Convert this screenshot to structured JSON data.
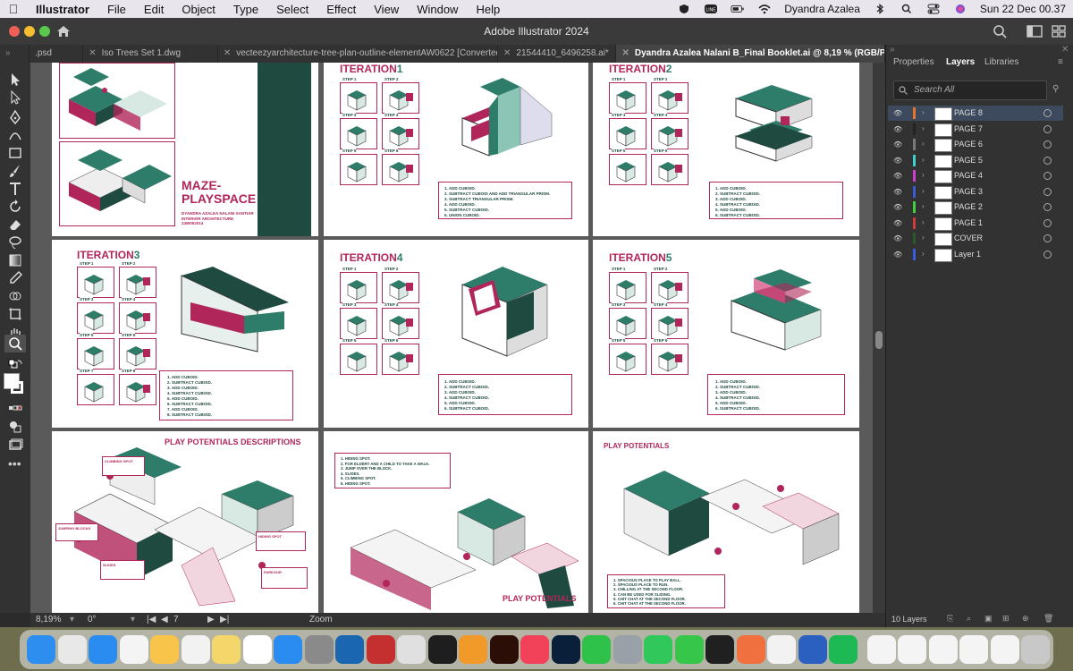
{
  "menubar": {
    "app": "Illustrator",
    "items": [
      "File",
      "Edit",
      "Object",
      "Type",
      "Select",
      "Effect",
      "View",
      "Window",
      "Help"
    ],
    "user": "Dyandra Azalea",
    "clock": "Sun 22 Dec  00.37"
  },
  "window": {
    "title": "Adobe Illustrator 2024"
  },
  "tabs": [
    {
      "label": ".psd"
    },
    {
      "label": "Iso Trees Set 1.dwg"
    },
    {
      "label": "vecteezyarchitecture-tree-plan-outline-elementAW0622 [Converted].eps"
    },
    {
      "label": "21544410_6496258.ai*"
    },
    {
      "label": "Dyandra Azalea Nalani B_Final Booklet.ai @ 8,19 % (RGB/Preview)"
    }
  ],
  "status": {
    "zoom": "8,19%",
    "rotation": "0°",
    "artboard": "7",
    "mode": "Zoom"
  },
  "panel": {
    "tabs": [
      "Properties",
      "Layers",
      "Libraries"
    ],
    "search_placeholder": "Search All",
    "layers": [
      {
        "name": "PAGE 8",
        "color": "#e8732c"
      },
      {
        "name": "PAGE 7",
        "color": "#222222"
      },
      {
        "name": "PAGE 6",
        "color": "#7a7a7a"
      },
      {
        "name": "PAGE 5",
        "color": "#3fd0d0"
      },
      {
        "name": "PAGE 4",
        "color": "#d040d0"
      },
      {
        "name": "PAGE 3",
        "color": "#3b5bd6"
      },
      {
        "name": "PAGE 2",
        "color": "#40d040"
      },
      {
        "name": "PAGE 1",
        "color": "#d03a3a"
      },
      {
        "name": "COVER",
        "color": "#2a5a2a"
      },
      {
        "name": "Layer 1",
        "color": "#3a5ae0"
      }
    ],
    "count": "10 Layers"
  },
  "artboards": {
    "cover": {
      "title1": "MAZE-",
      "title2": "PLAYSPACE",
      "sub1": "DYANDRA AZALEA NALANI SANTIAR",
      "sub2": "INTERIOR ARCHITECTURE",
      "sub3": "24W052014"
    },
    "iter1": {
      "title": "ITERATION",
      "num": "1",
      "notes": [
        "1.  ADD CUBOID.",
        "2.  SUBTRACT CUBOID AND ADD TRIANGULAR PRISM.",
        "3.  SUBTRACT TRIANGULAR PRISM.",
        "4.  ADD CUBOID.",
        "5.  SUBTRACT CUBOID.",
        "6.  UNION CUBOID."
      ]
    },
    "iter2": {
      "title": "ITERATION",
      "num": "2",
      "notes": [
        "1.  ADD CUBOID.",
        "2.  SUBTRACT CUBOID.",
        "3.  ADD CUBOID.",
        "4.  SUBTRACT CUBOID.",
        "5.  ADD CUBOID.",
        "6.  SUBTRACT CUBOID."
      ]
    },
    "iter3": {
      "title": "ITERATION",
      "num": "3",
      "notes": [
        "1.  ADD CUBOID.",
        "2.  SUBTRACT CUBOID.",
        "3.  ADD CUBOID.",
        "4.  SUBTRACT CUBOID.",
        "5.  ADD CUBOID.",
        "6.  SUBTRACT CUBOID.",
        "7.  ADD CUBOID.",
        "8.  SUBTRACT CUBOID."
      ]
    },
    "iter4": {
      "title": "ITERATION",
      "num": "4",
      "notes": [
        "1.  ADD CUBOID.",
        "2.  SUBTRACT CUBOID.",
        "3.  ADD CUBOID.",
        "4.  SUBTRACT CUBOID.",
        "5.  ADD CUBOID.",
        "6.  SUBTRACT CUBOID."
      ]
    },
    "iter5": {
      "title": "ITERATION",
      "num": "5",
      "notes": [
        "1.  ADD CUBOID.",
        "2.  SUBTRACT CUBOID.",
        "3.  ADD CUBOID.",
        "4.  SUBTRACT CUBOID.",
        "5.  ADD CUBOID.",
        "6.  SUBTRACT CUBOID."
      ]
    },
    "steps": [
      "STEP 1",
      "STEP 2",
      "STEP 3",
      "STEP 4",
      "STEP 5",
      "STEP 6",
      "STEP 7",
      "STEP 8"
    ],
    "pp_desc": {
      "title": "PLAY POTENTIALS DESCRIPTIONS",
      "labels": [
        "CLIMBING SPOT",
        "JUMPING BLOCKS",
        "HIDING SPOT",
        "SLIDES",
        "PARKOUR"
      ]
    },
    "pp_mid": {
      "title": "PLAY POTENTIALS",
      "notes": [
        "1.  HIDING SPOT.",
        "2.  FOR ELDERY AND A CHILD TO TAKE A WALK.",
        "3.  JUMP OVER THE BLOCK.",
        "4.  SLIDES.",
        "5.  CLIMBING SPOT.",
        "6.  HIDING SPOT."
      ]
    },
    "pp_right": {
      "title": "PLAY POTENTIALS",
      "notes": [
        "1.  SPACIOUS PLACE TO PLAY BALL.",
        "2.  SPACIOUS PLACE TO RUN.",
        "3.  CHILLING AT THE SECOND FLOOR.",
        "4.  CAN BE USED FOR SLIDING.",
        "5.  CHIT CHAT AT THE SECOND FLOOR.",
        "6.  CHIT CHAT AT THE SECOND FLOOR."
      ]
    }
  },
  "colors": {
    "teal": "#2e7d6b",
    "magenta": "#b0265a",
    "darkgreen": "#1f4a40"
  },
  "dock_icons": [
    "finder",
    "launchpad",
    "safari",
    "photos",
    "notes-app",
    "reminders",
    "notes",
    "freeform",
    "app-store",
    "system-settings",
    "sketchup",
    "autocad",
    "preview",
    "inkscape",
    "pages",
    "illustrator",
    "music",
    "photoshop",
    "whatsapp",
    "calculator",
    "line",
    "messages",
    "terminal",
    "spark",
    "chrome",
    "word",
    "spotify",
    "docs1",
    "docs2",
    "docs3",
    "docs4",
    "docs5",
    "trash"
  ]
}
